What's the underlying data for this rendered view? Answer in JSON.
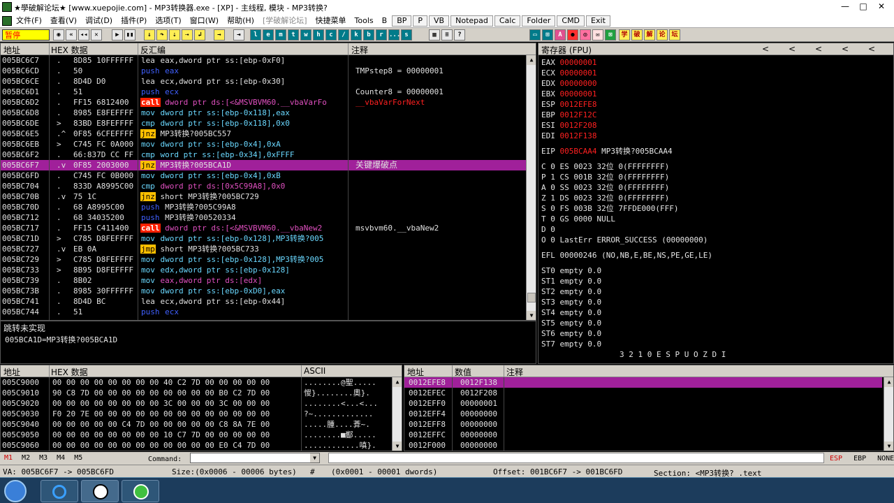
{
  "window": {
    "title": "★學破解论坛★ [www.xuepojie.com] - MP3转换器.exe - [XP] - 主线程, 模块 - MP3转换?",
    "minimize": "—",
    "restore": "□",
    "close": "✕"
  },
  "menu": {
    "items": [
      "文件(F)",
      "查看(V)",
      "调试(D)",
      "插件(P)",
      "选项(T)",
      "窗口(W)",
      "帮助(H)"
    ],
    "disabled": "[学破解论坛]",
    "more": [
      "快捷菜单",
      "Tools",
      "B"
    ],
    "quick": [
      "BP",
      "P",
      "VB",
      "Notepad",
      "Calc",
      "Folder",
      "CMD",
      "Exit"
    ]
  },
  "toolbar": {
    "status": "暂停",
    "letters": [
      "l",
      "e",
      "m",
      "t",
      "w",
      "h",
      "c",
      "/",
      "k",
      "b",
      "r",
      "...",
      "s"
    ],
    "cn": [
      "学",
      "破",
      "解",
      "论",
      "坛"
    ]
  },
  "disasm": {
    "headers": {
      "addr": "地址",
      "hex": "HEX 数据",
      "dis": "反汇编",
      "comment": "注释"
    },
    "rows": [
      {
        "addr": "005BC6C7",
        "m": ".",
        "hex": "8D85 10FFFFFF",
        "op": "lea",
        "args": "eax,dword ptr ss:[ebp-0xF0]",
        "cls": "k-lea",
        "ac": "ops-w",
        "cm": ""
      },
      {
        "addr": "005BC6CD",
        "m": ".",
        "hex": "50",
        "op": "push",
        "args": "eax",
        "cls": "k-push",
        "ac": "ops-push",
        "cm": ""
      },
      {
        "addr": "005BC6CE",
        "m": ".",
        "hex": "8D4D D0",
        "op": "lea",
        "args": "ecx,dword ptr ss:[ebp-0x30]",
        "cls": "k-lea",
        "ac": "ops-w",
        "cm": ""
      },
      {
        "addr": "005BC6D1",
        "m": ".",
        "hex": "51",
        "op": "push",
        "args": "ecx",
        "cls": "k-push",
        "ac": "ops-push",
        "cm": ""
      },
      {
        "addr": "005BC6D2",
        "m": ".",
        "hex": "FF15 6812400",
        "op": "call",
        "args": "dword ptr ds:[<&MSVBVM60.__vbaVarFo",
        "cls": "k-call",
        "ac": "ops-p",
        "cm": "__vbaVarForNext"
      },
      {
        "addr": "005BC6D8",
        "m": ".",
        "hex": "8985 E8FEFFFF",
        "op": "mov",
        "args": "dword ptr ss:[ebp-0x118],eax",
        "cls": "k-mov",
        "ac": "ops-mov",
        "cm": ""
      },
      {
        "addr": "005BC6DE",
        "m": ">",
        "hex": "83BD E8FEFFFF",
        "op": "cmp",
        "args": "dword ptr ss:[ebp-0x118],0x0",
        "cls": "k-cmp",
        "ac": "ops-mov",
        "cm": ""
      },
      {
        "addr": "005BC6E5",
        "m": ".^",
        "hex": "0F85 6CFEFFFF",
        "op": "jnz",
        "args": "MP3转换?005BC557",
        "cls": "k-jnz",
        "ac": "ops-w",
        "cm": ""
      },
      {
        "addr": "005BC6EB",
        "m": ">",
        "hex": "C745 FC 0A000",
        "op": "mov",
        "args": "dword ptr ss:[ebp-0x4],0xA",
        "cls": "k-mov",
        "ac": "ops-mov",
        "cm": ""
      },
      {
        "addr": "005BC6F2",
        "m": ".",
        "hex": "66:837D CC FF",
        "op": "cmp",
        "args": "word ptr ss:[ebp-0x34],0xFFFF",
        "cls": "k-cmp",
        "ac": "ops-mov",
        "cm": ""
      },
      {
        "addr": "005BC6F7",
        "m": ".v",
        "hex": "0F85 2003000",
        "op": "jnz",
        "args": "MP3转换?005BCA1D",
        "cls": "k-jnz",
        "ac": "ops-w",
        "cm": "关键爆破点",
        "sel": true
      },
      {
        "addr": "005BC6FD",
        "m": ".",
        "hex": "C745 FC 0B000",
        "op": "mov",
        "args": "dword ptr ss:[ebp-0x4],0xB",
        "cls": "k-mov",
        "ac": "ops-mov",
        "cm": ""
      },
      {
        "addr": "005BC704",
        "m": ".",
        "hex": "833D A8995C00",
        "op": "cmp",
        "args": "dword ptr ds:[0x5C99A8],0x0",
        "cls": "k-cmp",
        "ac": "ops-p",
        "cm": ""
      },
      {
        "addr": "005BC70B",
        "m": ".v",
        "hex": "75 1C",
        "op": "jnz",
        "args": "short MP3转换?005BC729",
        "cls": "k-jnz",
        "ac": "ops-w",
        "cm": ""
      },
      {
        "addr": "005BC70D",
        "m": ".",
        "hex": "68 A8995C00",
        "op": "push",
        "args": "MP3转换?005C99A8",
        "cls": "k-push",
        "ac": "ops-w",
        "cm": ""
      },
      {
        "addr": "005BC712",
        "m": ".",
        "hex": "68 34035200",
        "op": "push",
        "args": "MP3转换?00520334",
        "cls": "k-push",
        "ac": "ops-w",
        "cm": ""
      },
      {
        "addr": "005BC717",
        "m": ".",
        "hex": "FF15 C411400",
        "op": "call",
        "args": "dword ptr ds:[<&MSVBVM60.__vbaNew2",
        "cls": "k-call",
        "ac": "ops-p",
        "cm": "msvbvm60.__vbaNew2"
      },
      {
        "addr": "005BC71D",
        "m": ">",
        "hex": "C785 D8FEFFFF",
        "op": "mov",
        "args": "dword ptr ss:[ebp-0x128],MP3转换?005",
        "cls": "k-mov",
        "ac": "ops-mov",
        "cm": ""
      },
      {
        "addr": "005BC727",
        "m": ".v",
        "hex": "EB 0A",
        "op": "jmp",
        "args": "short MP3转换?005BC733",
        "cls": "k-jmp",
        "ac": "ops-w",
        "cm": ""
      },
      {
        "addr": "005BC729",
        "m": ">",
        "hex": "C785 D8FEFFFF",
        "op": "mov",
        "args": "dword ptr ss:[ebp-0x128],MP3转换?005",
        "cls": "k-mov",
        "ac": "ops-mov",
        "cm": ""
      },
      {
        "addr": "005BC733",
        "m": ">",
        "hex": "8B95 D8FEFFFF",
        "op": "mov",
        "args": "edx,dword ptr ss:[ebp-0x128]",
        "cls": "k-mov",
        "ac": "ops-mov",
        "cm": ""
      },
      {
        "addr": "005BC739",
        "m": ".",
        "hex": "8B02",
        "op": "mov",
        "args": "eax,dword ptr ds:[edx]",
        "cls": "k-mov",
        "ac": "ops-p",
        "cm": ""
      },
      {
        "addr": "005BC73B",
        "m": ".",
        "hex": "8985 30FFFFFF",
        "op": "mov",
        "args": "dword ptr ss:[ebp-0xD0],eax",
        "cls": "k-mov",
        "ac": "ops-mov",
        "cm": ""
      },
      {
        "addr": "005BC741",
        "m": ".",
        "hex": "8D4D BC",
        "op": "lea",
        "args": "ecx,dword ptr ss:[ebp-0x44]",
        "cls": "k-lea",
        "ac": "ops-w",
        "cm": ""
      },
      {
        "addr": "005BC744",
        "m": ".",
        "hex": "51",
        "op": "push",
        "args": "ecx",
        "cls": "k-push",
        "ac": "ops-push",
        "cm": ""
      }
    ],
    "side_comments": [
      {
        "text": "TMPstep8 = 00000001",
        "row": 1
      },
      {
        "text": "Counter8 = 00000001",
        "row": 3
      }
    ]
  },
  "info": {
    "line1": "跳转未实现",
    "line2": "005BCA1D=MP3转换?005BCA1D"
  },
  "registers": {
    "header": "寄存器 (FPU)",
    "regs": [
      [
        "EAX",
        "00000001"
      ],
      [
        "ECX",
        "00000001"
      ],
      [
        "EDX",
        "00000000"
      ],
      [
        "EBX",
        "00000001"
      ],
      [
        "ESP",
        "0012EFE8"
      ],
      [
        "EBP",
        "0012F12C"
      ],
      [
        "ESI",
        "0012F208"
      ],
      [
        "EDI",
        "0012F138"
      ]
    ],
    "eip": {
      "name": "EIP",
      "value": "005BCAA4",
      "desc": "MP3转换?005BCAA4"
    },
    "flags": [
      [
        "C 0",
        "ES 0023 32位 0(FFFFFFFF)"
      ],
      [
        "P 1",
        "CS 001B 32位 0(FFFFFFFF)"
      ],
      [
        "A 0",
        "SS 0023 32位 0(FFFFFFFF)"
      ],
      [
        "Z 1",
        "DS 0023 32位 0(FFFFFFFF)"
      ],
      [
        "S 0",
        "FS 003B 32位 7FFDE000(FFF)"
      ],
      [
        "T 0",
        "GS 0000 NULL"
      ],
      [
        "D 0",
        ""
      ],
      [
        "O 0",
        "LastErr ERROR_SUCCESS (00000000)"
      ]
    ],
    "efl": "EFL 00000246 (NO,NB,E,BE,NS,PE,GE,LE)",
    "st": [
      "ST0 empty 0.0",
      "ST1 empty 0.0",
      "ST2 empty 0.0",
      "ST3 empty 0.0",
      "ST4 empty 0.0",
      "ST5 empty 0.0",
      "ST6 empty 0.0",
      "ST7 empty 0.0"
    ],
    "fpu_bits": "3 2 1 0      E S P U O Z D I"
  },
  "dump": {
    "headers": {
      "addr": "地址",
      "hex": "HEX 数据",
      "ascii": "ASCII"
    },
    "rows": [
      {
        "a": "005C9000",
        "h": "00 00 00 00 00 00 00 00 40 C2 7D 00 00 00 00 00",
        "s": "........@聖....."
      },
      {
        "a": "005C9010",
        "h": "90 C8 7D 00 00 00 00 00 00 00 00 00 B0 C2 7D 00",
        "s": "惾}........奧}."
      },
      {
        "a": "005C9020",
        "h": "00 00 00 00 00 00 00 00 3C 00 00 00 3C 00 00 00",
        "s": "........<...<..."
      },
      {
        "a": "005C9030",
        "h": "F0 20 7E 00 00 00 00 00 00 00 00 00 00 00 00 00",
        "s": "?~............."
      },
      {
        "a": "005C9040",
        "h": "00 00 00 00 00 C4 7D 00 00 00 00 00 C8 8A 7E 00",
        "s": ".....腫....葊~."
      },
      {
        "a": "005C9050",
        "h": "00 00 00 00 00 00 00 00 10 C7 7D 00 00 00 00 00",
        "s": "........■酅....."
      },
      {
        "a": "005C9060",
        "h": "00 00 00 00 00 00 00 00 00 00 00 00 E0 C4 7D 00",
        "s": "............嗔}."
      }
    ]
  },
  "stack": {
    "headers": {
      "addr": "地址",
      "val": "数值",
      "comment": "注释"
    },
    "rows": [
      {
        "a": "0012EFE8",
        "v": "0012F138",
        "sel": true
      },
      {
        "a": "0012EFEC",
        "v": "0012F208"
      },
      {
        "a": "0012EFF0",
        "v": "00000001"
      },
      {
        "a": "0012EFF4",
        "v": "00000000"
      },
      {
        "a": "0012EFF8",
        "v": "00000000"
      },
      {
        "a": "0012EFFC",
        "v": "00000000"
      },
      {
        "a": "0012F000",
        "v": "00000000"
      }
    ]
  },
  "cmdbar": {
    "tabs": [
      "M1",
      "M2",
      "M3",
      "M4",
      "M5"
    ],
    "label": "Command:",
    "right": [
      "ESP",
      "EBP",
      "NONE"
    ]
  },
  "statusbar": {
    "va": "VA: 005BC6F7 -> 005BC6FD",
    "size": "Size:(0x0006 - 00006 bytes)",
    "hash": "#",
    "count": "(0x0001 - 00001 dwords)",
    "offset": "Offset: 001BC6F7 -> 001BC6FD",
    "section": "Section: <MP3转换? .text"
  }
}
